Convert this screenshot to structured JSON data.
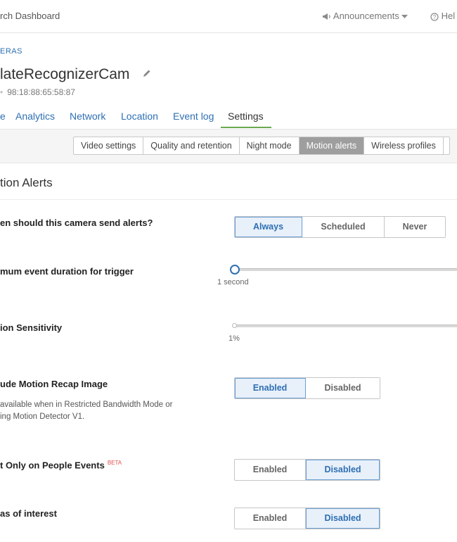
{
  "header": {
    "app_title": "rch Dashboard",
    "announcements_label": "Announcements",
    "help_label": "Hel"
  },
  "breadcrumb": "ERAS",
  "camera": {
    "name": "lateRecognizerCam",
    "mac": "98:18:88:65:58:87"
  },
  "nav_tabs": [
    {
      "label": "e"
    },
    {
      "label": "Analytics"
    },
    {
      "label": "Network"
    },
    {
      "label": "Location"
    },
    {
      "label": "Event log"
    },
    {
      "label": "Settings",
      "active": true
    }
  ],
  "sub_tabs": [
    {
      "label": "Video settings"
    },
    {
      "label": "Quality and retention"
    },
    {
      "label": "Night mode"
    },
    {
      "label": "Motion alerts",
      "active": true
    },
    {
      "label": "Wireless profiles"
    }
  ],
  "section_title": "tion Alerts",
  "send_alerts": {
    "label": "en should this camera send alerts?",
    "options": [
      "Always",
      "Scheduled",
      "Never"
    ],
    "selected": "Always"
  },
  "min_duration": {
    "label": "mum event duration for trigger",
    "value_label": "1 second",
    "level": 0
  },
  "sensitivity": {
    "label": "ion Sensitivity",
    "value_label": "1%",
    "level": 0
  },
  "recap_image": {
    "label": "ude Motion Recap Image",
    "help_line1": "available when in Restricted Bandwidth Mode or",
    "help_line2": "ing Motion Detector V1.",
    "options": [
      "Enabled",
      "Disabled"
    ],
    "selected": "Enabled"
  },
  "people_events": {
    "label": "t Only on People Events",
    "badge": "BETA",
    "options": [
      "Enabled",
      "Disabled"
    ],
    "selected": "Disabled"
  },
  "areas_of_interest": {
    "label": "as of interest",
    "options": [
      "Enabled",
      "Disabled"
    ],
    "selected": "Disabled"
  },
  "colors": {
    "link": "#2e6fb3",
    "active_tab_underline": "#6aa84f",
    "active_subtab": "#9e9e9e",
    "selected_option_bg": "#e8f0fa",
    "beta": "#d9534f"
  },
  "icons": [
    "megaphone-icon",
    "chevron-down-icon",
    "help-circle-icon",
    "pencil-icon"
  ]
}
